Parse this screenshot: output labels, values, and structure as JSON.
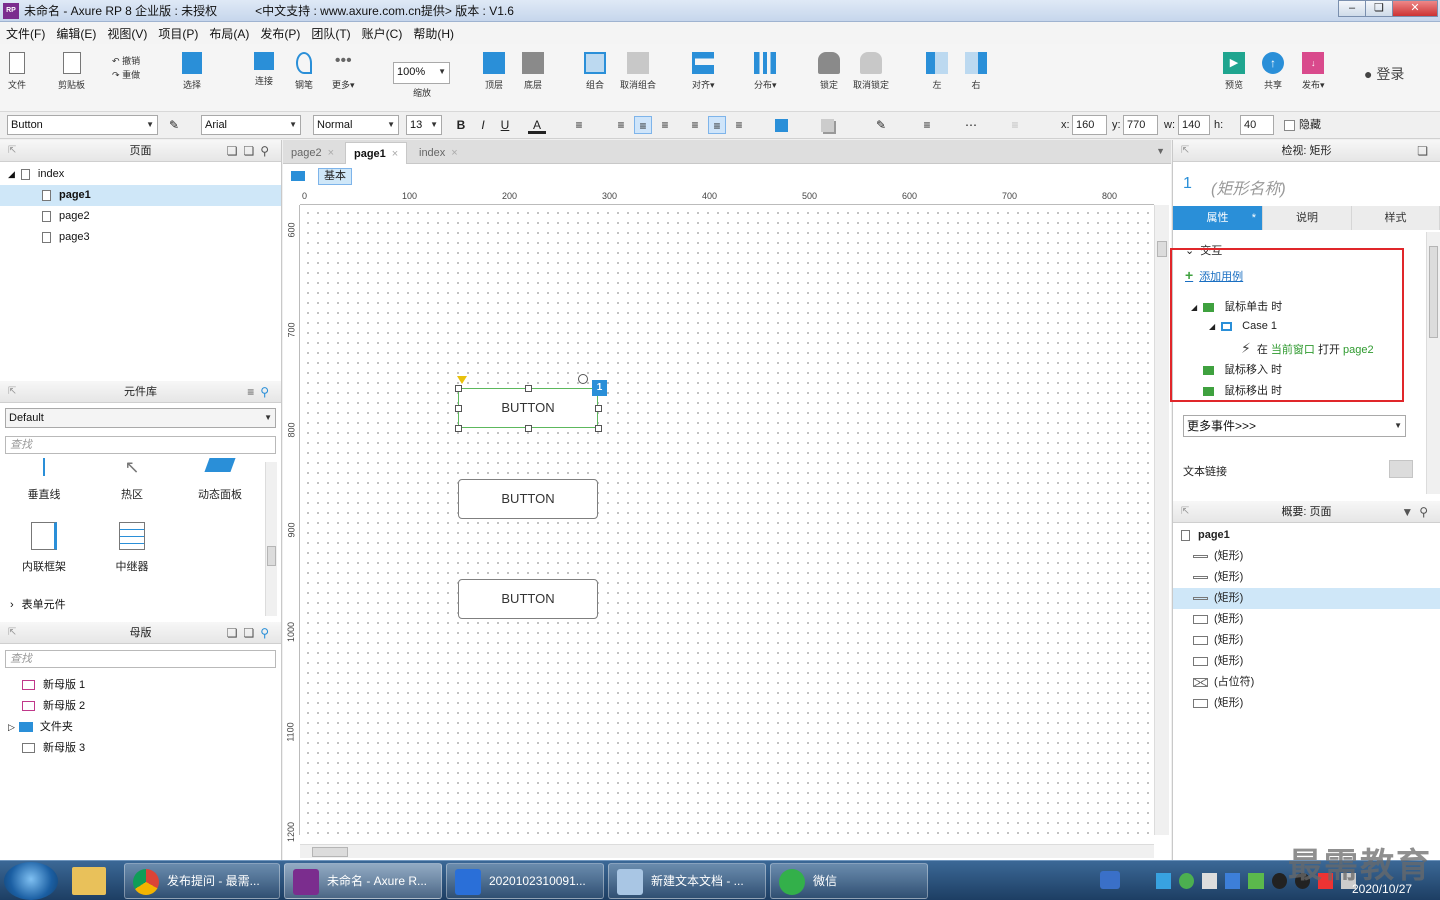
{
  "window": {
    "title": "未命名 - Axure RP 8 企业版 : 未授权",
    "support": "<中文支持 : www.axure.com.cn提供> 版本 : V1.6",
    "app_icon": "RP"
  },
  "menu": [
    "文件(F)",
    "编辑(E)",
    "视图(V)",
    "项目(P)",
    "布局(A)",
    "发布(P)",
    "团队(T)",
    "账户(C)",
    "帮助(H)"
  ],
  "toolbar": {
    "file": "文件",
    "clipboard": "剪贴板",
    "undo": "撤销",
    "redo": "重做",
    "select": "选择",
    "connect": "连接",
    "pen": "钢笔",
    "more": "更多▾",
    "zoom_value": "100%",
    "zoom": "缩放",
    "top": "顶层",
    "bottom": "底层",
    "group": "组合",
    "ungroup": "取消组合",
    "align": "对齐▾",
    "distribute": "分布▾",
    "lock": "锁定",
    "unlock": "取消锁定",
    "left": "左",
    "right": "右",
    "preview": "预览",
    "share": "共享",
    "publish": "发布▾",
    "login": "登录"
  },
  "format": {
    "widget": "Button",
    "font": "Arial",
    "weight": "Normal",
    "size": "13",
    "x_label": "x:",
    "x": "160",
    "y_label": "y:",
    "y": "770",
    "w_label": "w:",
    "w": "140",
    "h_label": "h:",
    "h": "40",
    "hide": "隐藏"
  },
  "pages_panel": {
    "title": "页面",
    "root": "index",
    "pages": [
      "page1",
      "page2",
      "page3"
    ]
  },
  "library_panel": {
    "title": "元件库",
    "library": "Default",
    "search": "查找",
    "items": [
      "垂直线",
      "热区",
      "动态面板",
      "内联框架",
      "中继器"
    ],
    "section": "表单元件"
  },
  "masters_panel": {
    "title": "母版",
    "search": "查找",
    "items": [
      "新母版 1",
      "新母版 2",
      "文件夹",
      "新母版 3"
    ]
  },
  "tabs": [
    "page2",
    "page1",
    "index"
  ],
  "canvas": {
    "adaptive": "基本",
    "ruler_h": [
      "0",
      "100",
      "200",
      "300",
      "400",
      "500",
      "600",
      "700",
      "800"
    ],
    "ruler_v": [
      "600",
      "700",
      "800",
      "900",
      "1000",
      "1100",
      "1200"
    ],
    "buttons": [
      "BUTTON",
      "BUTTON",
      "BUTTON"
    ],
    "badge": "1"
  },
  "inspector": {
    "title": "检视: 矩形",
    "index": "1",
    "name_placeholder": "(矩形名称)",
    "tabs": [
      "属性",
      "说明",
      "样式"
    ],
    "tab_marker": "*",
    "section": "交互",
    "add_case": "添加用例",
    "on_click": "鼠标单击 时",
    "case": "Case 1",
    "action_prefix": "在",
    "action_target": "当前窗口",
    "action_verb": "打开",
    "action_page": "page2",
    "on_enter": "鼠标移入 时",
    "on_leave": "鼠标移出 时",
    "more_events": "更多事件>>>",
    "text_link": "文本链接"
  },
  "outline": {
    "title": "概要: 页面",
    "page": "page1",
    "items": [
      "(矩形)",
      "(矩形)",
      "(矩形)",
      "(矩形)",
      "(矩形)",
      "(矩形)",
      "(占位符)",
      "(矩形)"
    ]
  },
  "taskbar": {
    "items": [
      "发布提问 - 最需...",
      "未命名 - Axure R...",
      "2020102310091...",
      "新建文本文档 - ...",
      "微信"
    ],
    "date": "2020/10/27",
    "watermark": "最需教育"
  },
  "colors": {
    "accent": "#2a8fd8",
    "highlight": "#e0262a",
    "flag": "#3fa13f"
  }
}
